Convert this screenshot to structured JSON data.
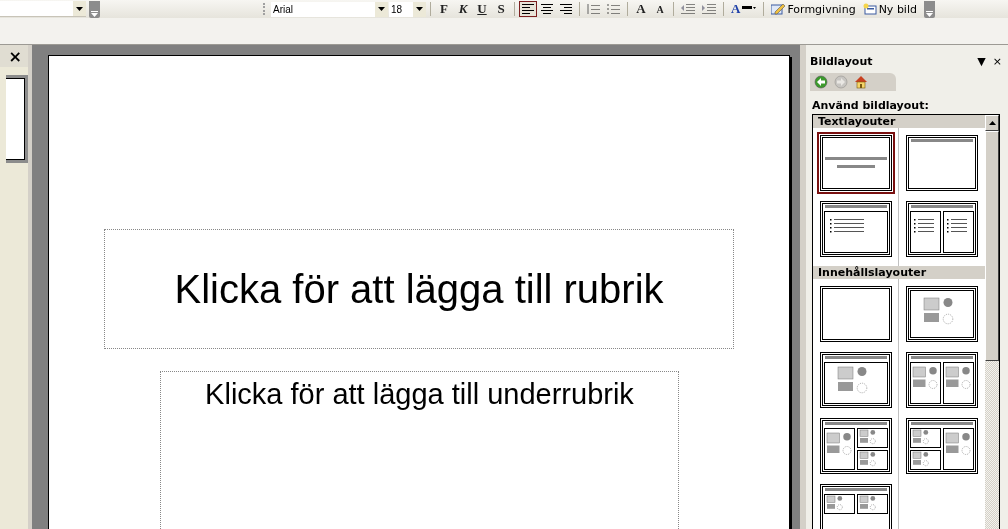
{
  "toolbar": {
    "font": "Arial",
    "size": "18",
    "groups": [
      [
        {
          "kind": "bold",
          "label": "F",
          "selected": false,
          "disabled": false
        },
        {
          "kind": "italic",
          "label": "K",
          "selected": false,
          "disabled": false
        },
        {
          "kind": "underline",
          "label": "U",
          "selected": false,
          "disabled": false
        },
        {
          "kind": "shadow",
          "label": "S",
          "selected": false,
          "disabled": false
        }
      ],
      [
        {
          "kind": "align-left",
          "selected": true,
          "disabled": false
        },
        {
          "kind": "align-center",
          "selected": false,
          "disabled": false
        },
        {
          "kind": "align-right",
          "selected": false,
          "disabled": false
        }
      ],
      [
        {
          "kind": "numbering",
          "selected": false,
          "disabled": true
        },
        {
          "kind": "bullets",
          "selected": false,
          "disabled": true
        }
      ],
      [
        {
          "kind": "grow-font",
          "label": "A",
          "selected": false,
          "disabled": false
        },
        {
          "kind": "shrink-font",
          "label": "A",
          "selected": false,
          "disabled": false
        }
      ],
      [
        {
          "kind": "decrease-indent",
          "selected": false,
          "disabled": true
        },
        {
          "kind": "increase-indent",
          "selected": false,
          "disabled": true
        }
      ],
      [
        {
          "kind": "font-color",
          "label": "A",
          "selected": false,
          "disabled": false
        }
      ],
      [
        {
          "kind": "design",
          "label": "Formgivning",
          "selected": false,
          "disabled": false
        },
        {
          "kind": "new-slide",
          "label": "Ny bild",
          "selected": false,
          "disabled": false
        }
      ]
    ]
  },
  "left_pane": {
    "close": "×"
  },
  "slide": {
    "title": "Klicka för att lägga till rubrik",
    "subtitle": "Klicka för att lägga till underrubrik"
  },
  "task_pane": {
    "title": "Bildlayout",
    "menu": "▼",
    "close": "×",
    "nav": [
      {
        "kind": "back",
        "disabled": false
      },
      {
        "kind": "forward",
        "disabled": true
      },
      {
        "kind": "home",
        "disabled": false
      }
    ],
    "heading": "Använd bildlayout:",
    "sections": [
      {
        "label": "Textlayouter",
        "layouts": [
          {
            "kind": "title",
            "selected": true
          },
          {
            "kind": "title-only",
            "selected": false
          },
          {
            "kind": "title-text",
            "selected": false
          },
          {
            "kind": "title-two-text",
            "selected": false
          }
        ]
      },
      {
        "label": "Innehållslayouter",
        "layouts": [
          {
            "kind": "blank",
            "selected": false
          },
          {
            "kind": "content",
            "selected": false
          },
          {
            "kind": "title-content",
            "selected": false
          },
          {
            "kind": "title-two-content",
            "selected": false
          },
          {
            "kind": "title-content-two-small",
            "selected": false
          },
          {
            "kind": "title-two-small-content",
            "selected": false
          },
          {
            "kind": "title-two-small",
            "selected": false
          }
        ]
      }
    ]
  }
}
